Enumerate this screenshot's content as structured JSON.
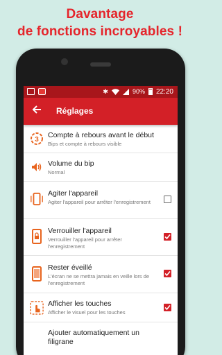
{
  "promo": {
    "line1": "Davantage",
    "line2": "de fonctions incroyables !"
  },
  "statusbar": {
    "battery": "90%",
    "time": "22:20",
    "icons": [
      "image-icon",
      "app-icon",
      "bluetooth-icon",
      "wifi-icon",
      "signal-icon",
      "battery-icon"
    ]
  },
  "toolbar": {
    "back_icon": "back-arrow-icon",
    "title": "Réglages"
  },
  "settings": [
    {
      "title": "Compte à rebours avant le début",
      "subtitle": "Bips et compte à rebours visible",
      "icon": "countdown-icon",
      "checkbox": null
    },
    {
      "title": "Volume du bip",
      "subtitle": "Normal",
      "icon": "volume-icon",
      "checkbox": null
    },
    {
      "title": "Agiter l'appareil",
      "subtitle": "Agiter l'appareil pour arrêter l'enregistrement",
      "icon": "shake-phone-icon",
      "checkbox": false
    },
    {
      "title": "Verrouiller l'appareil",
      "subtitle": "Verrouiller l'appareil pour arrêter l'enregistrement",
      "icon": "lock-phone-icon",
      "checkbox": true
    },
    {
      "title": "Rester éveillé",
      "subtitle": "L'écran ne se mettra jamais en veille lors de l'enregistrement",
      "icon": "phone-awake-icon",
      "checkbox": true
    },
    {
      "title": "Afficher les touches",
      "subtitle": "Afficher le visuel pour les touches",
      "icon": "touch-icon",
      "checkbox": true
    },
    {
      "title": "Ajouter automatiquement un filigrane",
      "subtitle": "",
      "icon": "watermark-icon",
      "checkbox": null
    }
  ],
  "colors": {
    "accent": "#d32027",
    "statusbar": "#a8161b",
    "background": "#d2ece6",
    "promo_text": "#e5252b"
  }
}
